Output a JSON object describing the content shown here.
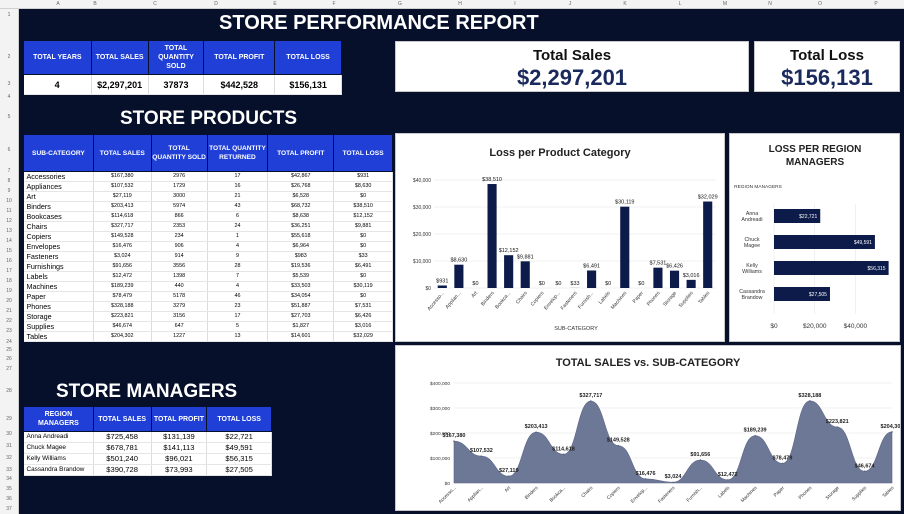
{
  "sheet": {
    "columns": [
      "A",
      "B",
      "C",
      "D",
      "E",
      "F",
      "G",
      "H",
      "I",
      "J",
      "K",
      "L",
      "M",
      "N",
      "O",
      "P"
    ],
    "rows": [
      "1",
      "2",
      "3",
      "4",
      "5",
      "6",
      "7",
      "8",
      "9",
      "10",
      "11",
      "12",
      "13",
      "14",
      "15",
      "16",
      "17",
      "18",
      "19",
      "20",
      "21",
      "22",
      "23",
      "24",
      "25",
      "26",
      "27",
      "28",
      "29",
      "30",
      "31",
      "32",
      "33",
      "34",
      "35",
      "36",
      "37"
    ]
  },
  "report_title": "STORE PERFORMANCE REPORT",
  "summary": {
    "headers": [
      "TOTAL YEARS",
      "TOTAL SALES",
      "TOTAL QUANTITY SOLD",
      "TOTAL PROFIT",
      "TOTAL LOSS"
    ],
    "values": [
      "4",
      "$2,297,201",
      "37873",
      "$442,528",
      "$156,131"
    ]
  },
  "kpi": {
    "sales_label": "Total Sales",
    "sales_value": "$2,297,201",
    "loss_label": "Total Loss",
    "loss_value": "$156,131"
  },
  "products": {
    "title": "STORE PRODUCTS",
    "headers": [
      "SUB-CATEGORY",
      "TOTAL SALES",
      "TOTAL QUANTITY SOLD",
      "TOTAL QUANTITY RETURNED",
      "TOTAL PROFIT",
      "TOTAL LOSS"
    ],
    "rows": [
      [
        "Accessories",
        "$167,380",
        "2976",
        "17",
        "$42,867",
        "$931"
      ],
      [
        "Appliances",
        "$107,532",
        "1729",
        "16",
        "$26,768",
        "$8,630"
      ],
      [
        "Art",
        "$27,119",
        "3000",
        "21",
        "$6,528",
        "$0"
      ],
      [
        "Binders",
        "$203,413",
        "5974",
        "43",
        "$68,732",
        "$38,510"
      ],
      [
        "Bookcases",
        "$114,618",
        "866",
        "6",
        "$8,638",
        "$12,152"
      ],
      [
        "Chairs",
        "$327,717",
        "2353",
        "24",
        "$36,251",
        "$9,881"
      ],
      [
        "Copiers",
        "$149,528",
        "234",
        "1",
        "$55,618",
        "$0"
      ],
      [
        "Envelopes",
        "$16,476",
        "906",
        "4",
        "$6,964",
        "$0"
      ],
      [
        "Fasteners",
        "$3,024",
        "914",
        "9",
        "$983",
        "$33"
      ],
      [
        "Furnishings",
        "$91,656",
        "3556",
        "28",
        "$19,536",
        "$6,491"
      ],
      [
        "Labels",
        "$12,472",
        "1398",
        "7",
        "$5,539",
        "$0"
      ],
      [
        "Machines",
        "$189,239",
        "440",
        "4",
        "$33,503",
        "$30,119"
      ],
      [
        "Paper",
        "$78,479",
        "5178",
        "46",
        "$34,054",
        "$0"
      ],
      [
        "Phones",
        "$328,188",
        "3279",
        "23",
        "$51,887",
        "$7,531"
      ],
      [
        "Storage",
        "$223,821",
        "3156",
        "17",
        "$27,703",
        "$6,426"
      ],
      [
        "Supplies",
        "$46,674",
        "647",
        "5",
        "$1,827",
        "$3,016"
      ],
      [
        "Tables",
        "$204,302",
        "1227",
        "13",
        "$14,601",
        "$32,029"
      ]
    ]
  },
  "managers": {
    "title": "STORE MANAGERS",
    "headers": [
      "REGION MANAGERS",
      "TOTAL SALES",
      "TOTAL PROFIT",
      "TOTAL LOSS"
    ],
    "rows": [
      [
        "Anna Andreadi",
        "$725,458",
        "$131,139",
        "$22,721"
      ],
      [
        "Chuck Magee",
        "$678,781",
        "$141,113",
        "$49,591"
      ],
      [
        "Kelly Williams",
        "$501,240",
        "$96,021",
        "$56,315"
      ],
      [
        "Cassandra Brandow",
        "$390,728",
        "$73,993",
        "$27,505"
      ]
    ]
  },
  "chart_data": [
    {
      "type": "bar",
      "title": "Loss per Product Category",
      "xlabel": "SUB-CATEGORY",
      "categories": [
        "Accesso...",
        "Applian...",
        "Art",
        "Binders",
        "Bookca...",
        "Chairs",
        "Copiers",
        "Envelop...",
        "Fasteners",
        "Furnish...",
        "Labels",
        "Machines",
        "Paper",
        "Phones",
        "Storage",
        "Supplies",
        "Tables"
      ],
      "values": [
        931,
        8630,
        0,
        38510,
        12152,
        9881,
        0,
        0,
        33,
        6491,
        0,
        30119,
        0,
        7531,
        6426,
        3016,
        32029
      ],
      "labels": [
        "$931",
        "$8,630",
        "$0",
        "$38,510",
        "$12,152",
        "$9,881",
        "$0",
        "$0",
        "$33",
        "$6,491",
        "$0",
        "$30,119",
        "$0",
        "$7,531",
        "$6,426",
        "$3,016",
        "$32,029"
      ],
      "yticks": [
        "$0",
        "$10,000",
        "$20,000",
        "$30,000",
        "$40,000"
      ],
      "ylim": [
        0,
        40000
      ],
      "color": "#0d1b4b"
    },
    {
      "type": "bar",
      "orientation": "horizontal",
      "title": "LOSS PER REGION MANAGERS",
      "axis_title": "REGION MANAGERS",
      "categories": [
        "Anna Andreadi",
        "Chuck Magee",
        "Kelly Williams",
        "Cassandra Brandow"
      ],
      "values": [
        22721,
        49591,
        56315,
        27505
      ],
      "labels": [
        "$22,721",
        "$49,591",
        "$56,315",
        "$27,505"
      ],
      "xticks": [
        "$0",
        "$20,000",
        "$40,000"
      ],
      "xlim": [
        0,
        57000
      ],
      "color": "#0d1b4b"
    },
    {
      "type": "area",
      "title": "TOTAL SALES vs. SUB-CATEGORY",
      "categories": [
        "Accesso...",
        "Applian...",
        "Art",
        "Binders",
        "Bookca...",
        "Chairs",
        "Copiers",
        "Envelop...",
        "Fasteners",
        "Furnish...",
        "Labels",
        "Machines",
        "Paper",
        "Phones",
        "Storage",
        "Supplies",
        "Tables"
      ],
      "values": [
        167380,
        107532,
        27119,
        203413,
        114618,
        327717,
        149528,
        16476,
        3024,
        91656,
        12472,
        189239,
        78479,
        328188,
        223821,
        46674,
        204302
      ],
      "labels": [
        "$167,380",
        "$107,532",
        "$27,119",
        "$203,413",
        "$114,618",
        "$327,717",
        "$149,528",
        "$16,476",
        "$3,024",
        "$91,656",
        "$12,472",
        "$189,239",
        "$78,479",
        "$328,188",
        "$223,821",
        "$46,674",
        "$204,302"
      ],
      "yticks": [
        "$0",
        "$100,000",
        "$200,000",
        "$300,000",
        "$400,000"
      ],
      "ylim": [
        0,
        400000
      ],
      "color": "#6d7796"
    }
  ]
}
